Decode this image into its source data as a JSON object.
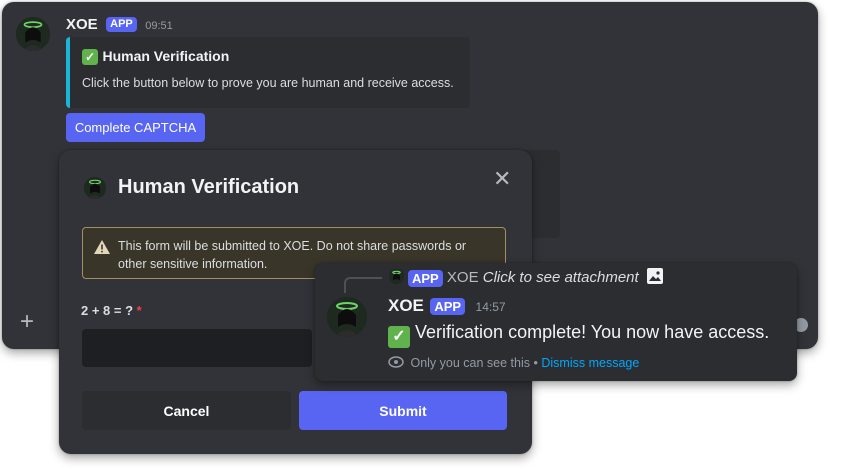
{
  "message": {
    "author": "XOE",
    "badge": "APP",
    "timestamp": "09:51",
    "embed": {
      "title_emoji": "✓",
      "title": "Human Verification",
      "description": "Click the button below to prove you are human and receive access."
    },
    "button_label": "Complete CAPTCHA"
  },
  "composer": {
    "plus_icon": "plus-icon",
    "emoji_icon": "emoji-icon"
  },
  "modal": {
    "title": "Human Verification",
    "close_symbol": "✕",
    "warning": "This form will be submitted to XOE. Do not share passwords or other sensitive information.",
    "question": "2 + 8 = ?",
    "required_mark": "*",
    "answer_value": "",
    "cancel_label": "Cancel",
    "submit_label": "Submit"
  },
  "reply": {
    "ref_badge": "APP",
    "ref_author": "XOE",
    "ref_text": "Click to see attachment",
    "author": "XOE",
    "badge": "APP",
    "timestamp": "14:57",
    "check_emoji": "✓",
    "body": "Verification complete! You now have access.",
    "visibility": "Only you can see this",
    "separator": "•",
    "dismiss": "Dismiss message"
  },
  "colors": {
    "accent": "#5865f2",
    "embed_border": "#1bb5d7",
    "check_green": "#5fb24c",
    "link": "#00a8fc",
    "warning_border": "#a48f62"
  }
}
